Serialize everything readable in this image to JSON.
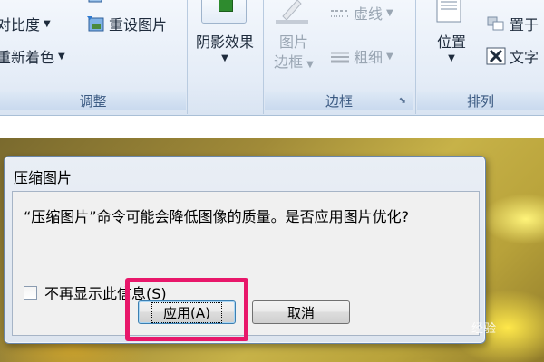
{
  "ribbon": {
    "adjust_group": {
      "label": "调整",
      "contrast": "对比度",
      "recolor": "重新着色",
      "reset_picture": "重设图片"
    },
    "shadow_effects": "阴影效果",
    "border_group": {
      "label": "边框",
      "picture_border_line1": "图片",
      "picture_border_line2": "边框",
      "dashes": "虚线",
      "weight": "粗细"
    },
    "arrange_group": {
      "label": "排列",
      "position": "位置",
      "text_wrap": "文字",
      "bring_to_front": "置于"
    }
  },
  "dialog": {
    "title": "压缩图片",
    "message": "“压缩图片”命令可能会降低图像的质量。是否应用图片优化?",
    "checkbox_label": "不再显示此信息(S)",
    "apply_button": "应用(A)",
    "cancel_button": "取消"
  },
  "watermark": "经验",
  "colors": {
    "highlight": "#e8176a",
    "ribbon_text": "#1e2b3c",
    "group_label": "#3b5a82"
  }
}
